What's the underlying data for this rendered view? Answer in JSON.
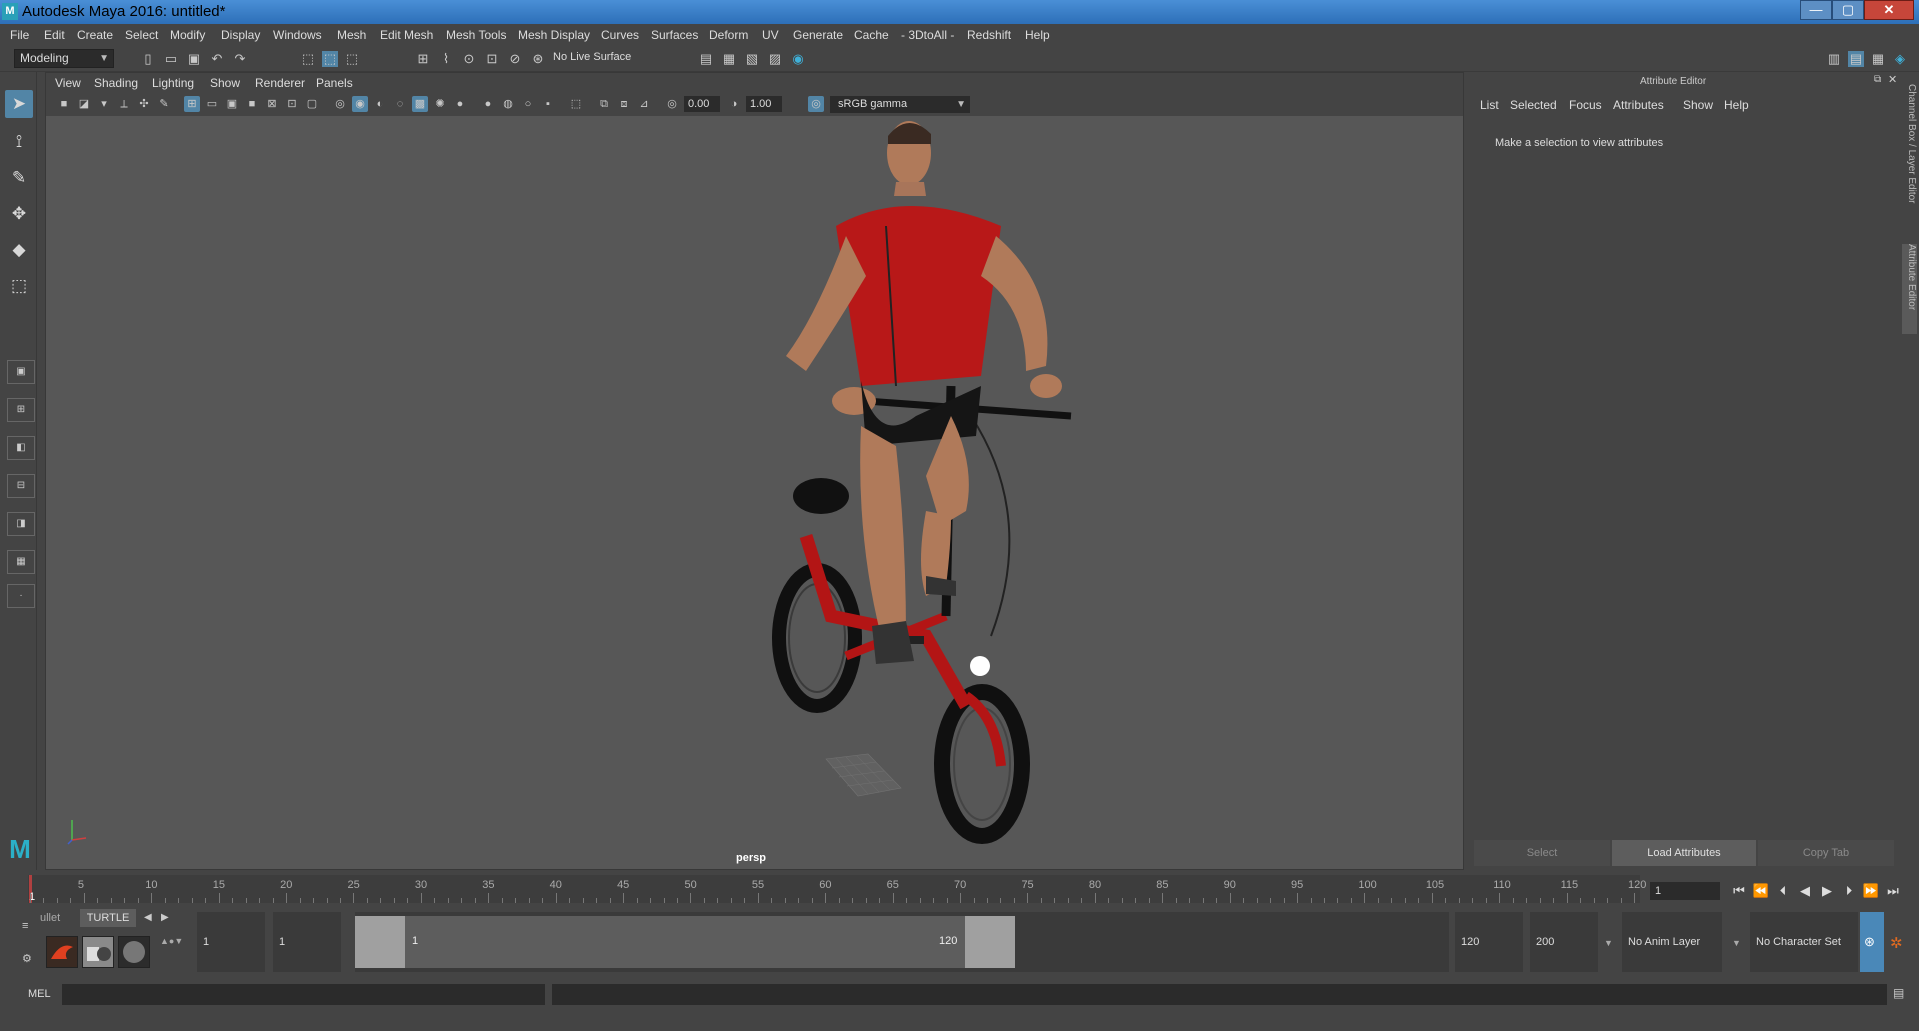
{
  "window": {
    "title": "Autodesk Maya 2016: untitled*",
    "logo_text": "M",
    "controls": {
      "minimize": "—",
      "maximize": "▢",
      "close": "✕"
    }
  },
  "menubar": {
    "items": [
      "File",
      "Edit",
      "Create",
      "Select",
      "Modify",
      "Display",
      "Windows",
      "Mesh",
      "Edit Mesh",
      "Mesh Tools",
      "Mesh Display",
      "Curves",
      "Surfaces",
      "Deform",
      "UV",
      "Generate",
      "Cache",
      "- 3DtoAll -",
      "Redshift",
      "Help"
    ]
  },
  "statusline": {
    "mode": "Modeling",
    "live_surface": "No Live Surface"
  },
  "viewport": {
    "menu": [
      "View",
      "Shading",
      "Lighting",
      "Show",
      "Renderer",
      "Panels"
    ],
    "exposure": "0.00",
    "gamma": "1.00",
    "colorspace": "sRGB gamma",
    "camera_label": "persp"
  },
  "attribute_editor": {
    "title": "Attribute Editor",
    "menu": [
      "List",
      "Selected",
      "Focus",
      "Attributes",
      "Show",
      "Help"
    ],
    "message": "Make a selection to view attributes",
    "buttons": {
      "select": "Select",
      "load": "Load Attributes",
      "copy_tab": "Copy Tab"
    },
    "side_tabs": {
      "channel_box": "Channel Box / Layer Editor",
      "attribute_editor": "Attribute Editor"
    }
  },
  "timeslider": {
    "ticks": [
      "1",
      "5",
      "10",
      "15",
      "20",
      "25",
      "30",
      "35",
      "40",
      "45",
      "50",
      "55",
      "60",
      "65",
      "70",
      "75",
      "80",
      "85",
      "90",
      "95",
      "100",
      "105",
      "110",
      "115",
      "120"
    ],
    "current_frame": "1",
    "playback_icons": [
      "⏮",
      "⏪",
      "⏴",
      "◀",
      "▶",
      "⏵",
      "⏩",
      "⏭"
    ]
  },
  "rangeslider": {
    "shelf_tab_left": "ullet",
    "shelf_tab": "TURTLE",
    "start": "1",
    "playback_start": "1",
    "range_start_label": "1",
    "range_end_label": "120",
    "playback_end": "120",
    "end": "200",
    "anim_layer": "No Anim Layer",
    "character_set": "No Character Set"
  },
  "cmdline": {
    "label": "MEL"
  }
}
